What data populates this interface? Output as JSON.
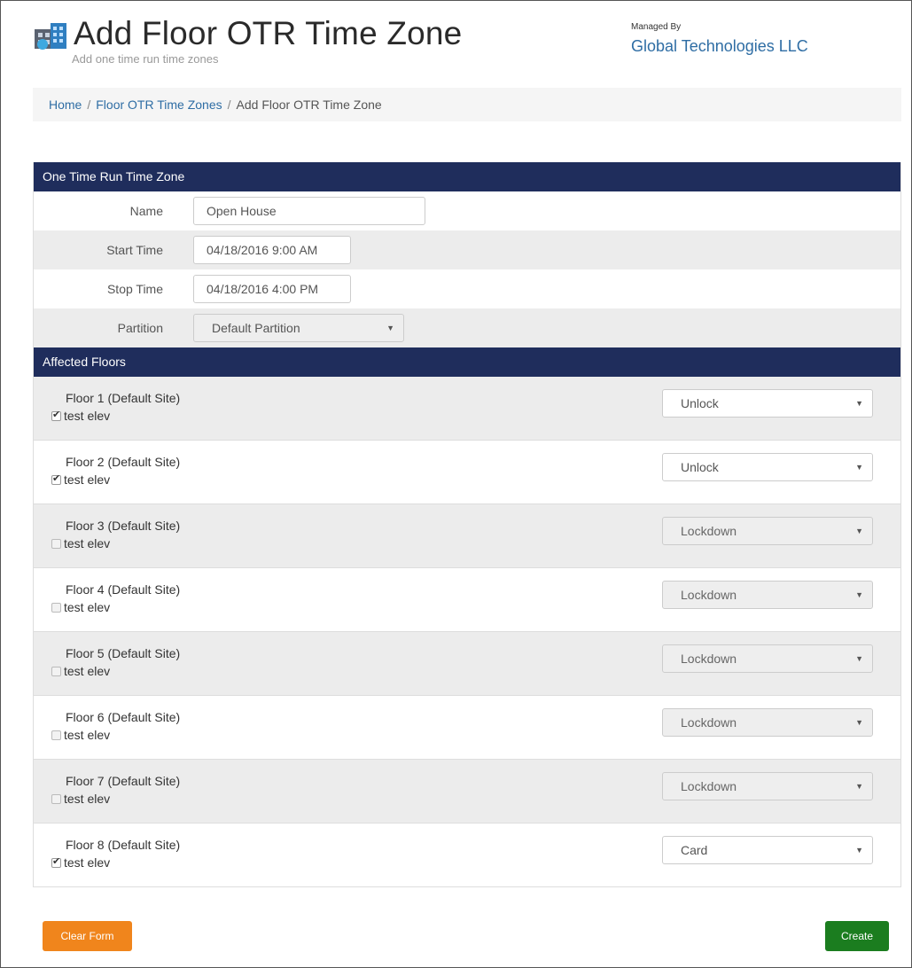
{
  "header": {
    "title": "Add Floor OTR Time Zone",
    "subtitle": "Add one time run time zones",
    "logo_icon": "otr-building-icon",
    "managed_label": "Managed By",
    "managed_org": "Global Technologies LLC"
  },
  "breadcrumb": {
    "items": [
      {
        "label": "Home",
        "link": true
      },
      {
        "label": "Floor OTR Time Zones",
        "link": true
      },
      {
        "label": "Add Floor OTR Time Zone",
        "link": false
      }
    ],
    "separator": "/"
  },
  "one_time_section": {
    "title": "One Time Run Time Zone",
    "name_label": "Name",
    "name_value": "Open House",
    "start_label": "Start Time",
    "start_value": "04/18/2016 9:00 AM",
    "stop_label": "Stop Time",
    "stop_value": "04/18/2016 4:00 PM",
    "partition_label": "Partition",
    "partition_value": "Default Partition"
  },
  "floors_section": {
    "title": "Affected Floors",
    "floors": [
      {
        "name": "Floor 1 (Default Site)",
        "check_label": "test elev",
        "checked": true,
        "mode": "Unlock",
        "enabled": true
      },
      {
        "name": "Floor 2 (Default Site)",
        "check_label": "test elev",
        "checked": true,
        "mode": "Unlock",
        "enabled": true
      },
      {
        "name": "Floor 3 (Default Site)",
        "check_label": "test elev",
        "checked": false,
        "mode": "Lockdown",
        "enabled": false
      },
      {
        "name": "Floor 4 (Default Site)",
        "check_label": "test elev",
        "checked": false,
        "mode": "Lockdown",
        "enabled": false
      },
      {
        "name": "Floor 5 (Default Site)",
        "check_label": "test elev",
        "checked": false,
        "mode": "Lockdown",
        "enabled": false
      },
      {
        "name": "Floor 6 (Default Site)",
        "check_label": "test elev",
        "checked": false,
        "mode": "Lockdown",
        "enabled": false
      },
      {
        "name": "Floor 7 (Default Site)",
        "check_label": "test elev",
        "checked": false,
        "mode": "Lockdown",
        "enabled": false
      },
      {
        "name": "Floor 8 (Default Site)",
        "check_label": "test elev",
        "checked": true,
        "mode": "Card",
        "enabled": true
      }
    ]
  },
  "actions": {
    "clear_label": "Clear Form",
    "create_label": "Create"
  },
  "colors": {
    "section_header": "#1f2d5c",
    "clear_button": "#f0851c",
    "create_button": "#1b7d1f",
    "link": "#2e6da4"
  }
}
